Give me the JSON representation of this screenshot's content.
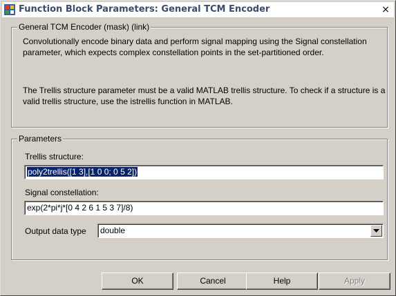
{
  "window": {
    "title": "Function Block Parameters: General TCM Encoder",
    "close_label": "×"
  },
  "description_group": {
    "legend": "General TCM Encoder (mask) (link)",
    "paragraphs": [
      "Convolutionally encode binary data and perform signal mapping using the Signal constellation parameter, which expects complex constellation points in the set-partitioned order.",
      "The Trellis structure parameter must be a valid MATLAB trellis structure. To check if a structure is a valid trellis structure, use the istrellis function in MATLAB."
    ]
  },
  "parameters_group": {
    "legend": "Parameters",
    "trellis_label": "Trellis structure:",
    "trellis_value": "poly2trellis([1 3],[1 0 0; 0 5 2])",
    "constellation_label": "Signal constellation:",
    "constellation_value": "exp(2*pi*j*[0 4 2 6 1 5 3 7]/8)",
    "output_type_label": "Output data type",
    "output_type_value": "double"
  },
  "buttons": {
    "ok": "OK",
    "cancel": "Cancel",
    "help": "Help",
    "apply": "Apply"
  },
  "icons": {
    "app": "simulink-block-icon",
    "dropdown": "chevron-down-icon"
  }
}
